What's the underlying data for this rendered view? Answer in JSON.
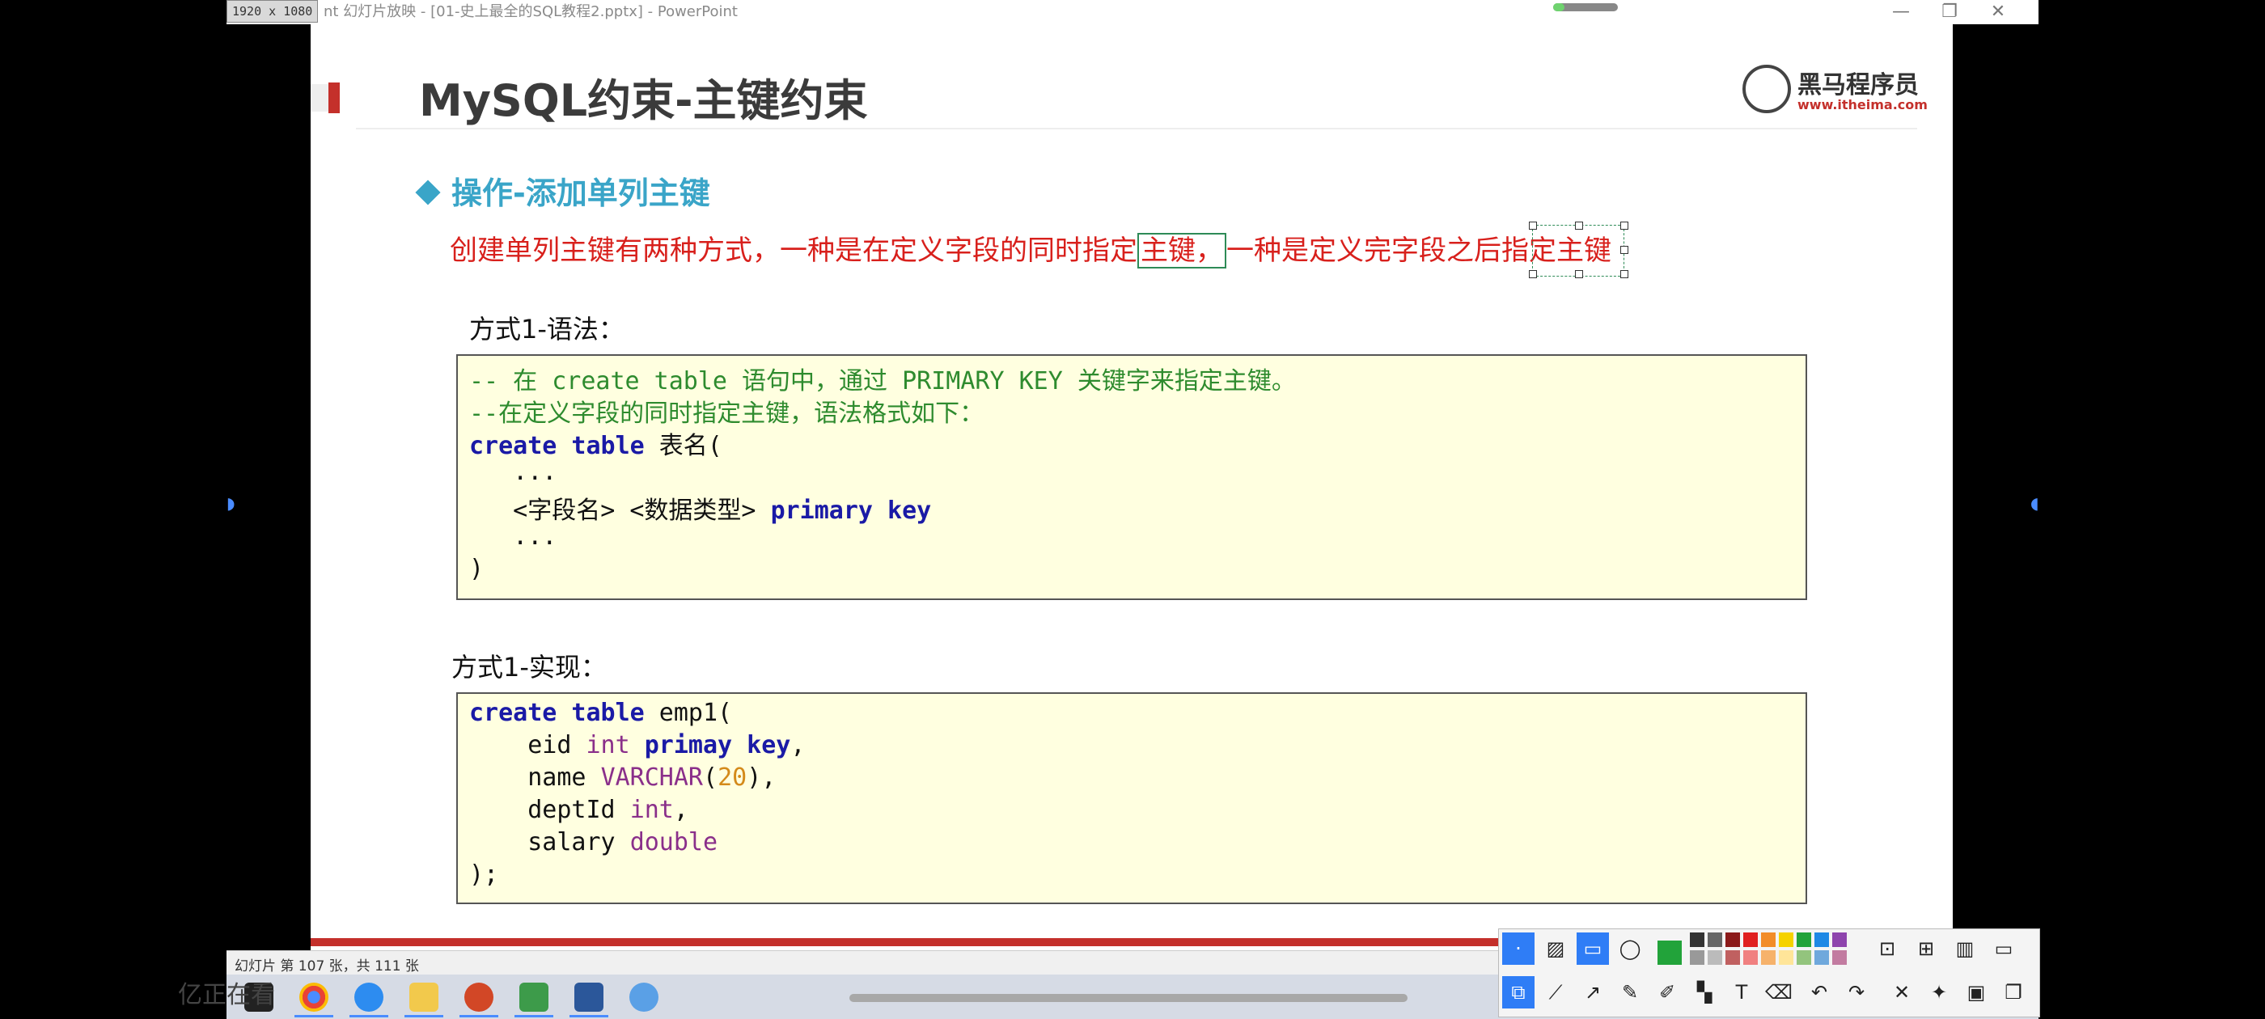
{
  "window": {
    "resolution_badge": "1920 x 1080",
    "title": "nt 幻灯片放映 - [01-史上最全的SQL教程2.pptx] - PowerPoint",
    "minimize": "—",
    "restore": "❐",
    "close": "✕"
  },
  "slide": {
    "title": "MySQL约束-主键约束",
    "logo_name": "黑马程序员",
    "logo_url": "www.itheima.com",
    "section_heading": "操作-添加单列主键",
    "description": {
      "part1": "创建单列主键有两种方式，一种是在定义字段的同时指定",
      "boxed": "主键，",
      "part2": "一种是定义完字段之后指定主键"
    },
    "syntax_label": "方式1-语法：",
    "impl_label": "方式1-实现：",
    "code1": {
      "l1": "-- 在 create table 语句中，通过 PRIMARY KEY 关键字来指定主键。",
      "l2": "--在定义字段的同时指定主键，语法格式如下：",
      "l3_kw": "create table",
      "l3_rest": " 表名(",
      "l4": "   ...",
      "l5_a": "   <字段名> <数据类型> ",
      "l5_kw": "primary key",
      "l6": "   ...",
      "l7": ")"
    },
    "code2": {
      "l1_kw": "create table",
      "l1_rest": " emp1(",
      "l2_a": "    eid ",
      "l2_ty": "int",
      "l2_kw": " primay key",
      "l2_end": ",",
      "l3_a": "    name ",
      "l3_ty": "VARCHAR",
      "l3_p1": "(",
      "l3_num": "20",
      "l3_p2": "),",
      "l4_a": "    deptId ",
      "l4_ty": "int",
      "l4_end": ",",
      "l5_a": "    salary ",
      "l5_ty": "double",
      "l6": ");"
    }
  },
  "status": {
    "text": "幻灯片 第 107 张，共 111 张"
  },
  "taskbar": {
    "watermark": "亿正在看"
  },
  "colors": {
    "accent_red": "#c4302b",
    "heading_blue": "#3aa5c8",
    "comment_green": "#2e8b2e",
    "keyword_blue": "#1a1aa6",
    "toolbar_blue": "#2f7df6"
  }
}
